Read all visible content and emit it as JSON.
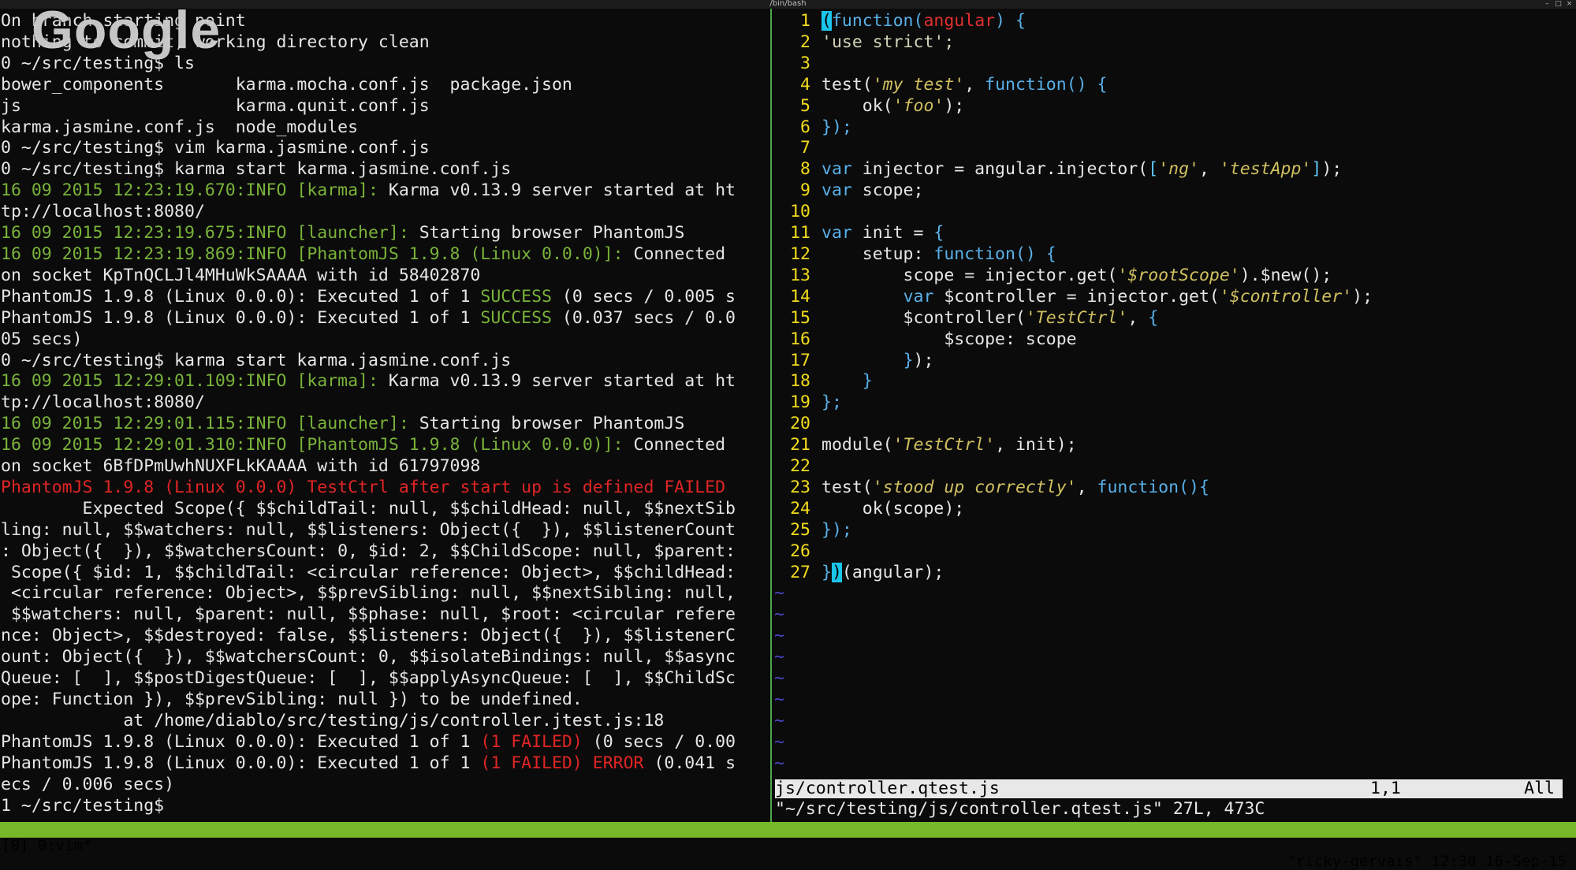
{
  "window": {
    "title": "/bin/bash"
  },
  "overlay": {
    "logo_text": "Google"
  },
  "left_pane": {
    "lines": [
      {
        "segs": [
          {
            "t": "On branch starting point"
          }
        ]
      },
      {
        "segs": [
          {
            "t": "nothing to commit, working directory clean"
          }
        ]
      },
      {
        "segs": [
          {
            "t": "0 ~/src/testing$ ls"
          }
        ]
      },
      {
        "segs": [
          {
            "t": "bower_components       karma.mocha.conf.js  package.json"
          }
        ]
      },
      {
        "segs": [
          {
            "t": "js                     karma.qunit.conf.js"
          }
        ]
      },
      {
        "segs": [
          {
            "t": "karma.jasmine.conf.js  node_modules"
          }
        ]
      },
      {
        "segs": [
          {
            "t": "0 ~/src/testing$ vim karma.jasmine.conf.js"
          }
        ]
      },
      {
        "segs": [
          {
            "t": "0 ~/src/testing$ karma start karma.jasmine.conf.js"
          }
        ]
      },
      {
        "segs": [
          {
            "t": "16 09 2015 12:23:19.670:INFO [karma]: ",
            "c": "g"
          },
          {
            "t": "Karma v0.13.9 server started at ht"
          }
        ]
      },
      {
        "segs": [
          {
            "t": "tp://localhost:8080/"
          }
        ]
      },
      {
        "segs": [
          {
            "t": "16 09 2015 12:23:19.675:INFO [launcher]: ",
            "c": "g"
          },
          {
            "t": "Starting browser PhantomJS"
          }
        ]
      },
      {
        "segs": [
          {
            "t": "16 09 2015 12:23:19.869:INFO [PhantomJS 1.9.8 (Linux 0.0.0)]: ",
            "c": "g"
          },
          {
            "t": "Connected"
          }
        ]
      },
      {
        "segs": [
          {
            "t": "on socket KpTnQCLJl4MHuWkSAAAA with id 58402870"
          }
        ]
      },
      {
        "segs": [
          {
            "t": "PhantomJS 1.9.8 (Linux 0.0.0): Executed 1 of 1 "
          },
          {
            "t": "SUCCESS",
            "c": "g"
          },
          {
            "t": " (0 secs / 0.005 s"
          }
        ]
      },
      {
        "segs": [
          {
            "t": "PhantomJS 1.9.8 (Linux 0.0.0): Executed 1 of 1 "
          },
          {
            "t": "SUCCESS",
            "c": "g"
          },
          {
            "t": " (0.037 secs / 0.0"
          }
        ]
      },
      {
        "segs": [
          {
            "t": "05 secs)"
          }
        ]
      },
      {
        "segs": [
          {
            "t": "0 ~/src/testing$ karma start karma.jasmine.conf.js"
          }
        ]
      },
      {
        "segs": [
          {
            "t": "16 09 2015 12:29:01.109:INFO [karma]: ",
            "c": "g"
          },
          {
            "t": "Karma v0.13.9 server started at ht"
          }
        ]
      },
      {
        "segs": [
          {
            "t": "tp://localhost:8080/"
          }
        ]
      },
      {
        "segs": [
          {
            "t": "16 09 2015 12:29:01.115:INFO [launcher]: ",
            "c": "g"
          },
          {
            "t": "Starting browser PhantomJS"
          }
        ]
      },
      {
        "segs": [
          {
            "t": "16 09 2015 12:29:01.310:INFO [PhantomJS 1.9.8 (Linux 0.0.0)]: ",
            "c": "g"
          },
          {
            "t": "Connected"
          }
        ]
      },
      {
        "segs": [
          {
            "t": "on socket 6BfDPmUwhNUXFLkKAAAA with id 61797098"
          }
        ]
      },
      {
        "segs": [
          {
            "t": "PhantomJS 1.9.8 (Linux 0.0.0) TestCtrl after start up is defined FAILED",
            "c": "r"
          }
        ]
      },
      {
        "segs": [
          {
            "t": "        Expected Scope({ $$childTail: null, $$childHead: null, $$nextSib"
          }
        ]
      },
      {
        "segs": [
          {
            "t": "ling: null, $$watchers: null, $$listeners: Object({  }), $$listenerCount"
          }
        ]
      },
      {
        "segs": [
          {
            "t": ": Object({  }), $$watchersCount: 0, $id: 2, $$ChildScope: null, $parent:"
          }
        ]
      },
      {
        "segs": [
          {
            "t": " Scope({ $id: 1, $$childTail: <circular reference: Object>, $$childHead:"
          }
        ]
      },
      {
        "segs": [
          {
            "t": " <circular reference: Object>, $$prevSibling: null, $$nextSibling: null,"
          }
        ]
      },
      {
        "segs": [
          {
            "t": " $$watchers: null, $parent: null, $$phase: null, $root: <circular refere"
          }
        ]
      },
      {
        "segs": [
          {
            "t": "nce: Object>, $$destroyed: false, $$listeners: Object({  }), $$listenerC"
          }
        ]
      },
      {
        "segs": [
          {
            "t": "ount: Object({  }), $$watchersCount: 0, $$isolateBindings: null, $$async"
          }
        ]
      },
      {
        "segs": [
          {
            "t": "Queue: [  ], $$postDigestQueue: [  ], $$applyAsyncQueue: [  ], $$ChildSc"
          }
        ]
      },
      {
        "segs": [
          {
            "t": "ope: Function }), $$prevSibling: null }) to be undefined."
          }
        ]
      },
      {
        "segs": [
          {
            "t": "            at /home/diablo/src/testing/js/controller.jtest.js:18"
          }
        ]
      },
      {
        "segs": [
          {
            "t": "PhantomJS 1.9.8 (Linux 0.0.0): Executed 1 of 1 "
          },
          {
            "t": "(1 FAILED)",
            "c": "r"
          },
          {
            "t": " (0 secs / 0.00"
          }
        ]
      },
      {
        "segs": [
          {
            "t": "PhantomJS 1.9.8 (Linux 0.0.0): Executed 1 of 1 "
          },
          {
            "t": "(1 FAILED)",
            "c": "r"
          },
          {
            "t": " "
          },
          {
            "t": "ERROR",
            "c": "r"
          },
          {
            "t": " (0.041 s"
          }
        ]
      },
      {
        "segs": [
          {
            "t": "ecs / 0.006 secs)"
          }
        ]
      },
      {
        "segs": [
          {
            "t": "1 ~/src/testing$ "
          }
        ]
      }
    ]
  },
  "editor": {
    "lines": [
      {
        "n": "1",
        "segs": [
          {
            "t": "(",
            "c": "cur"
          },
          {
            "t": "function",
            "c": "k"
          },
          {
            "t": "(",
            "c": "k"
          },
          {
            "t": "angular",
            "c": "ang"
          },
          {
            "t": ") {",
            "c": "k"
          }
        ]
      },
      {
        "n": "2",
        "segs": [
          {
            "t": "'use strict';",
            "c": "s"
          }
        ]
      },
      {
        "n": "3",
        "segs": []
      },
      {
        "n": "4",
        "segs": [
          {
            "t": "test("
          },
          {
            "t": "'my test'",
            "c": "st"
          },
          {
            "t": ", "
          },
          {
            "t": "function",
            "c": "k"
          },
          {
            "t": "() {",
            "c": "k"
          }
        ]
      },
      {
        "n": "5",
        "segs": [
          {
            "t": "    ok("
          },
          {
            "t": "'foo'",
            "c": "st"
          },
          {
            "t": ");"
          }
        ]
      },
      {
        "n": "6",
        "segs": [
          {
            "t": "});",
            "c": "k"
          }
        ]
      },
      {
        "n": "7",
        "segs": []
      },
      {
        "n": "8",
        "segs": [
          {
            "t": "var",
            "c": "k"
          },
          {
            "t": " injector = angular.injector("
          },
          {
            "t": "[",
            "c": "brk"
          },
          {
            "t": "'ng'",
            "c": "st"
          },
          {
            "t": ", "
          },
          {
            "t": "'testApp'",
            "c": "st"
          },
          {
            "t": "]",
            "c": "brk"
          },
          {
            "t": ");"
          }
        ]
      },
      {
        "n": "9",
        "segs": [
          {
            "t": "var",
            "c": "k"
          },
          {
            "t": " scope;"
          }
        ]
      },
      {
        "n": "10",
        "segs": []
      },
      {
        "n": "11",
        "segs": [
          {
            "t": "var",
            "c": "k"
          },
          {
            "t": " init = "
          },
          {
            "t": "{",
            "c": "k"
          }
        ]
      },
      {
        "n": "12",
        "segs": [
          {
            "t": "    setup: "
          },
          {
            "t": "function",
            "c": "k"
          },
          {
            "t": "() {",
            "c": "k"
          }
        ]
      },
      {
        "n": "13",
        "segs": [
          {
            "t": "        scope = injector.get("
          },
          {
            "t": "'$rootScope'",
            "c": "st"
          },
          {
            "t": ").$new();"
          }
        ]
      },
      {
        "n": "14",
        "segs": [
          {
            "t": "        "
          },
          {
            "t": "var",
            "c": "k"
          },
          {
            "t": " $controller = injector.get("
          },
          {
            "t": "'$controller'",
            "c": "st"
          },
          {
            "t": ");"
          }
        ]
      },
      {
        "n": "15",
        "segs": [
          {
            "t": "        $controller("
          },
          {
            "t": "'TestCtrl'",
            "c": "st"
          },
          {
            "t": ", "
          },
          {
            "t": "{",
            "c": "k"
          }
        ]
      },
      {
        "n": "16",
        "segs": [
          {
            "t": "            $scope: scope"
          }
        ]
      },
      {
        "n": "17",
        "segs": [
          {
            "t": "        "
          },
          {
            "t": "}",
            "c": "k"
          },
          {
            "t": ");"
          }
        ]
      },
      {
        "n": "18",
        "segs": [
          {
            "t": "    "
          },
          {
            "t": "}",
            "c": "k"
          }
        ]
      },
      {
        "n": "19",
        "segs": [
          {
            "t": "};",
            "c": "k"
          }
        ]
      },
      {
        "n": "20",
        "segs": []
      },
      {
        "n": "21",
        "segs": [
          {
            "t": "module("
          },
          {
            "t": "'TestCtrl'",
            "c": "st"
          },
          {
            "t": ", init);"
          }
        ]
      },
      {
        "n": "22",
        "segs": []
      },
      {
        "n": "23",
        "segs": [
          {
            "t": "test("
          },
          {
            "t": "'stood up correctly'",
            "c": "st"
          },
          {
            "t": ", "
          },
          {
            "t": "function",
            "c": "k"
          },
          {
            "t": "(){",
            "c": "k"
          }
        ]
      },
      {
        "n": "24",
        "segs": [
          {
            "t": "    ok(scope);"
          }
        ]
      },
      {
        "n": "25",
        "segs": [
          {
            "t": "});",
            "c": "k"
          }
        ]
      },
      {
        "n": "26",
        "segs": []
      },
      {
        "n": "27",
        "segs": [
          {
            "t": "}",
            "c": "k"
          },
          {
            "t": ")",
            "c": "cur"
          },
          {
            "t": "(angular);"
          }
        ]
      }
    ],
    "tilde_rows": [
      "~",
      "~",
      "~",
      "~",
      "~",
      "~",
      "~",
      "~",
      "~"
    ],
    "status": {
      "filename": "js/controller.qtest.js",
      "position": "1,1",
      "scroll": "All"
    },
    "command_line": "\"~/src/testing/js/controller.qtest.js\" 27L, 473C"
  },
  "tmux": {
    "left": "[0] 0:vim*",
    "right": "\"ricky-gervais\" 12:30 16-Sep-15"
  }
}
